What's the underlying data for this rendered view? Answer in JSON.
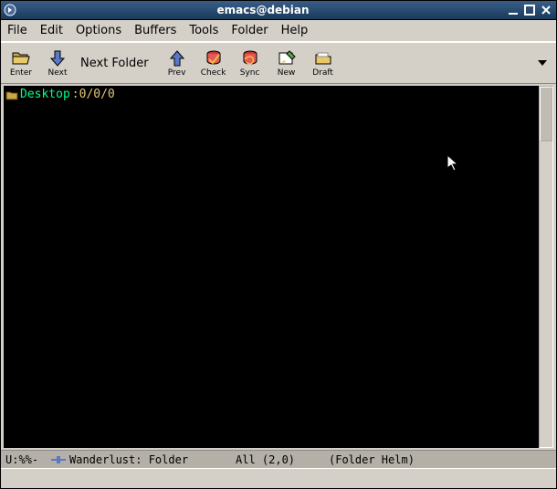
{
  "window": {
    "title": "emacs@debian"
  },
  "menu": {
    "file": "File",
    "edit": "Edit",
    "options": "Options",
    "buffers": "Buffers",
    "tools": "Tools",
    "folder": "Folder",
    "help": "Help"
  },
  "toolbar": {
    "enter": "Enter",
    "next": "Next",
    "next_folder": "Next Folder",
    "prev": "Prev",
    "check": "Check",
    "sync": "Sync",
    "new": "New",
    "draft": "Draft"
  },
  "buffer": {
    "folder_label": "Desktop",
    "folder_counts": ":0/0/0"
  },
  "modeline": {
    "left": "U:%%-",
    "mode": "Wanderlust: Folder",
    "position": "All (2,0)",
    "minor": "(Folder Helm)"
  }
}
